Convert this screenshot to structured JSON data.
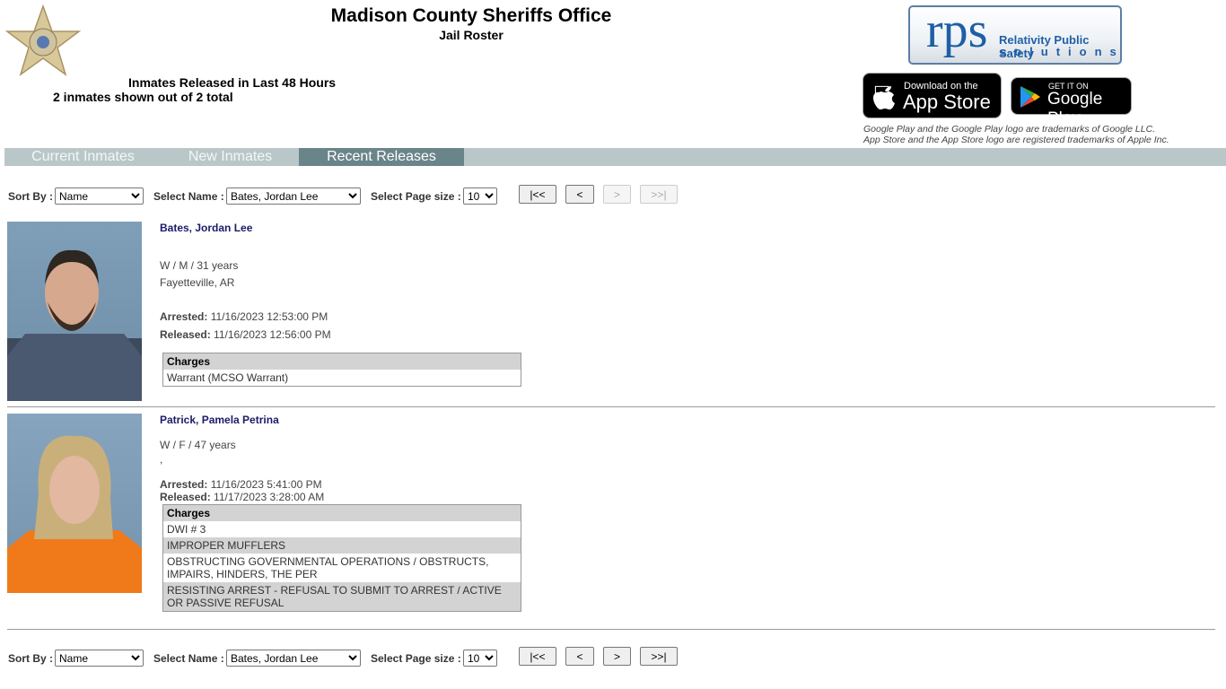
{
  "header": {
    "title": "Madison County Sheriffs Office",
    "subtitle": "Jail Roster",
    "released_heading": "Inmates Released in Last 48 Hours",
    "count_text": "2 inmates shown out of 2 total"
  },
  "logo": {
    "rps": "rps",
    "rps_line1": "Relativity Public Safety",
    "rps_line2": "solutions"
  },
  "stores": {
    "apple_small": "Download on the",
    "apple_big": "App Store",
    "google_small": "GET IT ON",
    "google_big": "Google Play",
    "trademark1": "Google Play and the Google Play logo are trademarks of Google LLC.",
    "trademark2": "App Store and the App Store logo are registered trademarks of Apple Inc."
  },
  "tabs": [
    {
      "label": "Current Inmates"
    },
    {
      "label": "New Inmates"
    },
    {
      "label": "Recent Releases",
      "active": true
    }
  ],
  "controls": {
    "sort_label": "Sort By :",
    "sort_value": "Name",
    "name_label": "Select Name :",
    "name_value": "Bates, Jordan Lee",
    "size_label": "Select Page size :",
    "size_value": "10",
    "first": "|<<",
    "prev": "<",
    "next": ">",
    "last": ">>|"
  },
  "inmates": [
    {
      "name": "Bates, Jordan Lee",
      "demo": "W / M / 31 years",
      "location": "Fayetteville, AR",
      "arrested_label": "Arrested:",
      "arrested": "11/16/2023 12:53:00 PM",
      "released_label": "Released:",
      "released": "11/16/2023 12:56:00 PM",
      "charges_header": "Charges",
      "charges": [
        "Warrant (MCSO Warrant)"
      ]
    },
    {
      "name": "Patrick, Pamela Petrina",
      "demo": "W / F / 47 years",
      "location": ",",
      "arrested_label": "Arrested:",
      "arrested": "11/16/2023 5:41:00 PM",
      "released_label": "Released:",
      "released": "11/17/2023 3:28:00 AM",
      "charges_header": "Charges",
      "charges": [
        "DWI # 3",
        "IMPROPER MUFFLERS",
        "OBSTRUCTING GOVERNMENTAL OPERATIONS / OBSTRUCTS, IMPAIRS, HINDERS, THE PER",
        "RESISTING ARREST - REFUSAL TO SUBMIT TO ARREST / ACTIVE OR PASSIVE REFUSAL"
      ]
    }
  ],
  "colors": {
    "tab_bar": "#b9c7c9",
    "tab_active": "#6a8589",
    "name": "#1b1b6b"
  }
}
